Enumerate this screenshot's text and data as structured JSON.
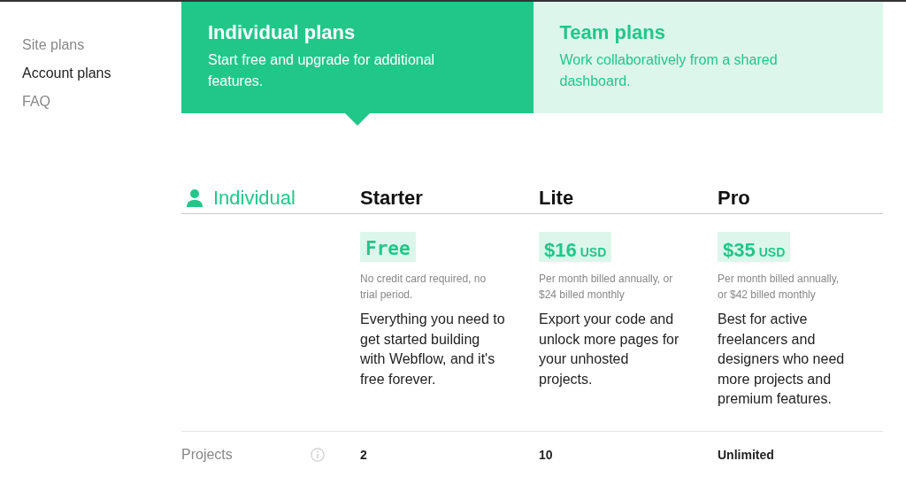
{
  "sidebar": {
    "items": [
      {
        "label": "Site plans",
        "selected": false
      },
      {
        "label": "Account plans",
        "selected": true
      },
      {
        "label": "FAQ",
        "selected": false
      }
    ]
  },
  "tabs": [
    {
      "title": "Individual plans",
      "subtitle": "Start free and upgrade for additional features.",
      "selected": true
    },
    {
      "title": "Team plans",
      "subtitle": "Work collaboratively from a shared dashboard.",
      "selected": false
    }
  ],
  "table": {
    "heading": "Individual",
    "plans": [
      {
        "name": "Starter",
        "price": "Free",
        "kind": "free",
        "note": "No credit card required, no trial period.",
        "description": "Everything you need to get started building with Webflow, and it's free forever."
      },
      {
        "name": "Lite",
        "price": "$16",
        "currency": "USD",
        "kind": "paid",
        "note": "Per month billed annually, or $24 billed monthly",
        "description": "Export your code and unlock more pages for your unhosted projects."
      },
      {
        "name": "Pro",
        "price": "$35",
        "currency": "USD",
        "kind": "paid",
        "note": "Per month billed annually, or $42 billed monthly",
        "description": "Best for active freelancers and designers who need more projects and premium features."
      }
    ],
    "rows": [
      {
        "label": "Projects",
        "values": [
          "2",
          "10",
          "Unlimited"
        ]
      }
    ]
  }
}
